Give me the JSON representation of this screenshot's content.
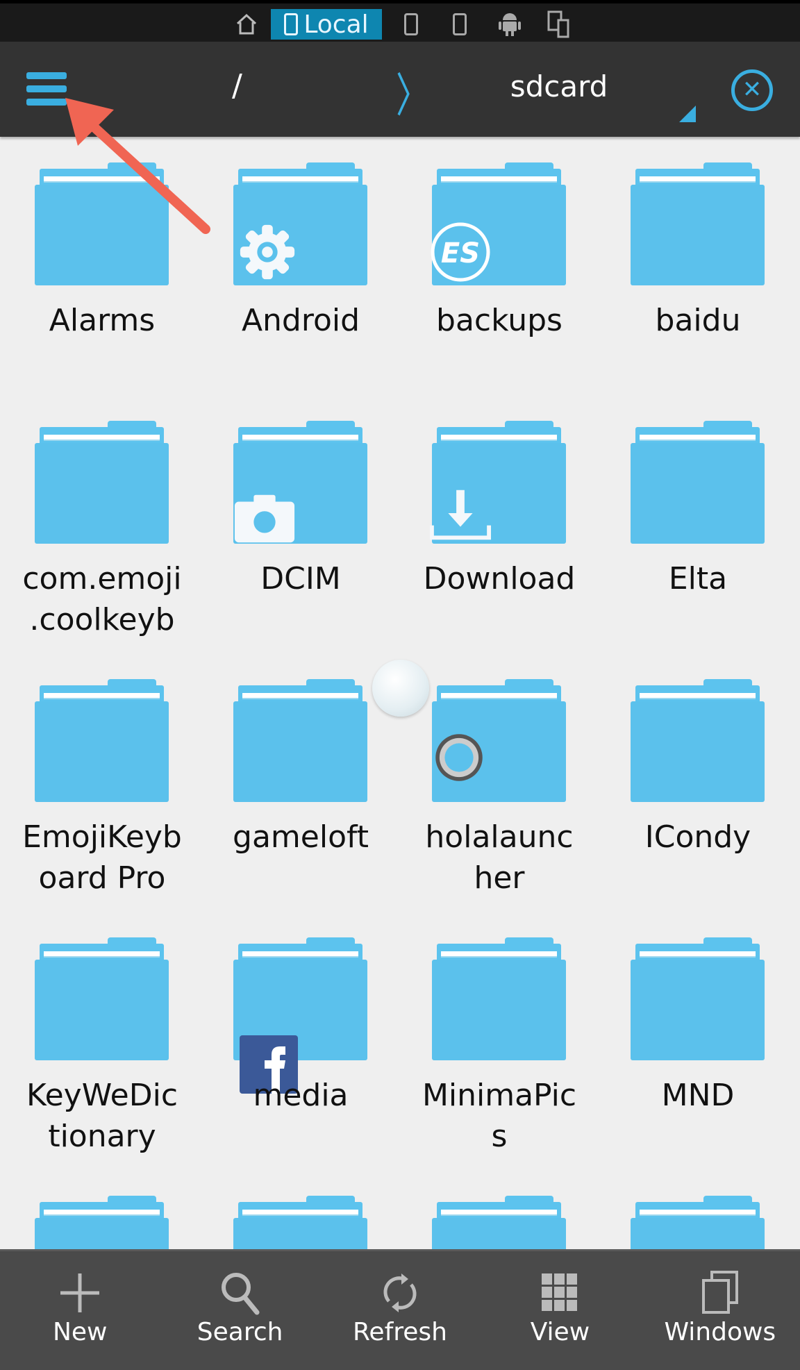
{
  "top_tabs": {
    "home_icon": "home-icon",
    "local_label": "Local",
    "others": [
      "phone-icon",
      "phone-icon",
      "android-icon",
      "devices-icon"
    ]
  },
  "header": {
    "menu_icon": "hamburger-icon",
    "path_root": "/",
    "separator": "〉",
    "current_folder": "sdcard",
    "close_icon": "close-circle-icon"
  },
  "accent": "#3aaee0",
  "folders": [
    {
      "name": "Alarms",
      "badge": ""
    },
    {
      "name": "Android",
      "badge": "gear"
    },
    {
      "name": "backups",
      "badge": "es"
    },
    {
      "name": "baidu",
      "badge": ""
    },
    {
      "name": "com.emoji\n.coolkeyb",
      "badge": ""
    },
    {
      "name": "DCIM",
      "badge": "camera"
    },
    {
      "name": "Download",
      "badge": "download"
    },
    {
      "name": "Elta",
      "badge": ""
    },
    {
      "name": "EmojiKeyb\noard Pro",
      "badge": ""
    },
    {
      "name": "gameloft",
      "badge": ""
    },
    {
      "name": "holalaunc\nher",
      "badge": "ring"
    },
    {
      "name": "ICondy",
      "badge": ""
    },
    {
      "name": "KeyWeDic\ntionary",
      "badge": ""
    },
    {
      "name": "media",
      "badge": "facebook"
    },
    {
      "name": "MinimaPic\ns",
      "badge": ""
    },
    {
      "name": "MND",
      "badge": ""
    },
    {
      "name": "",
      "badge": ""
    },
    {
      "name": "",
      "badge": ""
    },
    {
      "name": "",
      "badge": ""
    },
    {
      "name": "",
      "badge": ""
    }
  ],
  "bottom_bar": [
    {
      "label": "New",
      "icon": "plus-icon"
    },
    {
      "label": "Search",
      "icon": "search-icon"
    },
    {
      "label": "Refresh",
      "icon": "refresh-icon"
    },
    {
      "label": "View",
      "icon": "grid-icon"
    },
    {
      "label": "Windows",
      "icon": "windows-icon"
    }
  ]
}
